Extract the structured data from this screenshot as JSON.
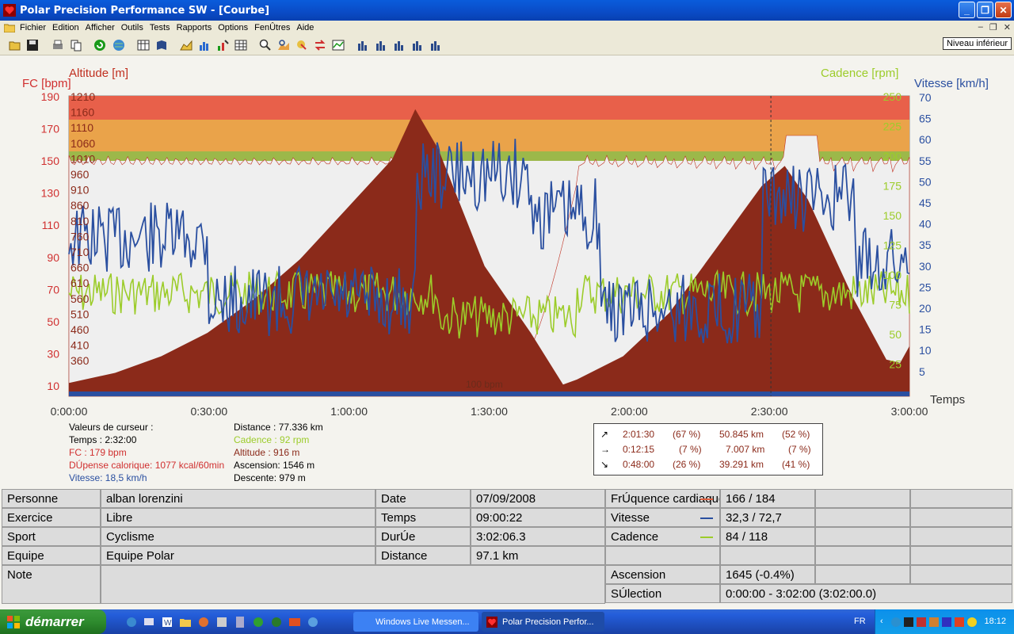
{
  "window": {
    "title": "Polar Precision Performance SW - [Courbe]"
  },
  "menu": [
    "Fichier",
    "Edition",
    "Afficher",
    "Outils",
    "Tests",
    "Rapports",
    "Options",
    "FenÛtres",
    "Aide"
  ],
  "toolbar": {
    "niveau_label": "Niveau inférieur"
  },
  "chart_data": {
    "type": "line",
    "axes": {
      "fc": {
        "label": "FC [bpm]",
        "ticks": [
          "190",
          "170",
          "150",
          "130",
          "110",
          "90",
          "70",
          "50",
          "30",
          "10"
        ]
      },
      "altitude": {
        "label": "Altitude  [m]",
        "ticks": [
          "1210",
          "1160",
          "1110",
          "1060",
          "1010",
          "960",
          "910",
          "860",
          "810",
          "760",
          "710",
          "660",
          "610",
          "560",
          "510",
          "460",
          "410",
          "360"
        ]
      },
      "cadence": {
        "label": "Cadence [rpm]",
        "ticks": [
          "250",
          "225",
          "200",
          "175",
          "150",
          "125",
          "100",
          "75",
          "50",
          "25"
        ]
      },
      "vitesse": {
        "label": "Vitesse [km/h]",
        "ticks": [
          "70",
          "65",
          "60",
          "55",
          "50",
          "45",
          "40",
          "35",
          "30",
          "25",
          "20",
          "15",
          "10",
          "5"
        ]
      },
      "time": {
        "label": "Temps",
        "ticks": [
          "0:00:00",
          "0:30:00",
          "1:00:00",
          "1:30:00",
          "2:00:00",
          "2:30:00",
          "3:00:00"
        ]
      }
    },
    "zone_label": "100 bpm",
    "series": [
      {
        "name": "Altitude",
        "color": "#8b2a1a",
        "x_min": [
          0,
          10,
          20,
          30,
          40,
          50,
          60,
          70,
          75,
          80,
          90,
          100,
          107,
          110,
          120,
          130,
          140,
          150,
          155,
          160,
          170,
          177,
          180,
          182
        ],
        "values": [
          350,
          380,
          430,
          500,
          600,
          720,
          870,
          1020,
          1170,
          1050,
          700,
          500,
          345,
          360,
          430,
          560,
          750,
          940,
          1000,
          900,
          600,
          420,
          410,
          460
        ]
      },
      {
        "name": "FC",
        "color": "#e06040"
      },
      {
        "name": "Vitesse",
        "color": "#2a4fa0"
      },
      {
        "name": "Cadence",
        "color": "#9ccc2a"
      }
    ]
  },
  "cursor": {
    "header": "Valeurs de curseur :",
    "temps": "Temps : 2:32:00",
    "fc": "FC : 179 bpm",
    "depense": "DÚpense calorique: 1077 kcal/60min",
    "vitesse": "Vitesse: 18,5 km/h",
    "distance": "Distance : 77.336 km",
    "cadence": "Cadence : 92 rpm",
    "altitude": "Altitude : 916 m",
    "ascension": "Ascension: 1546 m",
    "descente": "Descente: 979 m"
  },
  "summary": [
    {
      "arrow": "↗",
      "time": "2:01:30",
      "pct": "(67 %)",
      "dist": "50.845 km",
      "dpct": "(52 %)"
    },
    {
      "arrow": "→",
      "time": "0:12:15",
      "pct": "(7 %)",
      "dist": "7.007 km",
      "dpct": "(7 %)"
    },
    {
      "arrow": "↘",
      "time": "0:48:00",
      "pct": "(26 %)",
      "dist": "39.291 km",
      "dpct": "(41 %)"
    }
  ],
  "details": {
    "personne_label": "Personne",
    "personne": "alban lorenzini",
    "exercice_label": "Exercice",
    "exercice": "Libre",
    "sport_label": "Sport",
    "sport": "Cyclisme",
    "equipe_label": "Equipe",
    "equipe": "Equipe Polar",
    "note_label": "Note",
    "date_label": "Date",
    "date": "07/09/2008",
    "temps_label": "Temps",
    "temps": "09:00:22",
    "duree_label": "DurÚe",
    "duree": "3:02:06.3",
    "distance_label": "Distance",
    "distance": "97.1 km",
    "fc_label": "FrÚquence cardiaque",
    "fc": "166 / 184",
    "vitesse_label": "Vitesse",
    "vitesse": "32,3 / 72,7",
    "cadence_label": "Cadence",
    "cadence": "84 / 118",
    "ascension_label": "Ascension",
    "ascension": "1645 (-0.4%)",
    "selection_label": "SÚlection",
    "selection": "0:00:00 - 3:02:00 (3:02:00.0)"
  },
  "taskbar": {
    "start": "démarrer",
    "tasks": [
      "Windows Live Messen...",
      "Polar Precision Perfor..."
    ],
    "lang": "FR",
    "clock": "18:12"
  }
}
